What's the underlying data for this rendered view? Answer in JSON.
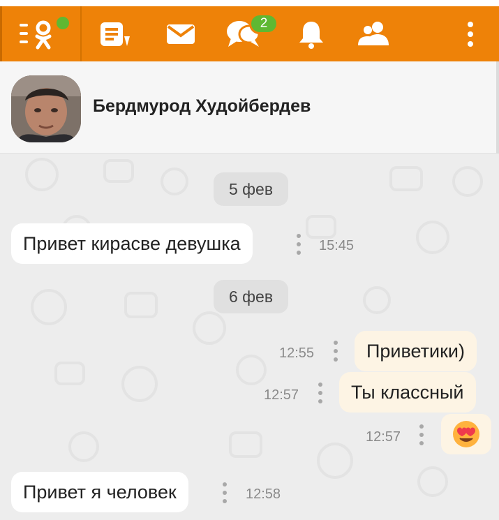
{
  "topbar": {
    "menu_icon": "ok-logo-menu-icon",
    "notes_icon": "notes-icon",
    "mail_icon": "mail-icon",
    "chat_icon": "chat-icon",
    "chat_badge": "2",
    "bell_icon": "bell-icon",
    "friends_icon": "friends-icon",
    "more_icon": "more-vertical-icon",
    "accent_color": "#ee8208",
    "badge_color": "#5fb832"
  },
  "header": {
    "contact_name": "Бердмурод Худойбердев"
  },
  "chat": {
    "dates": [
      "5 фев",
      "6 фев"
    ],
    "messages": [
      {
        "direction": "in",
        "text": "Привет кирасве девушка",
        "time": "15:45"
      },
      {
        "direction": "out",
        "text": "Приветики)",
        "time": "12:55"
      },
      {
        "direction": "out",
        "text": "Ты классный",
        "time": "12:57"
      },
      {
        "direction": "out",
        "emoji": "smiling-face-with-heart-eyes",
        "time": "12:57"
      },
      {
        "direction": "in",
        "text": "Привет я человек",
        "time": "12:58"
      }
    ]
  }
}
